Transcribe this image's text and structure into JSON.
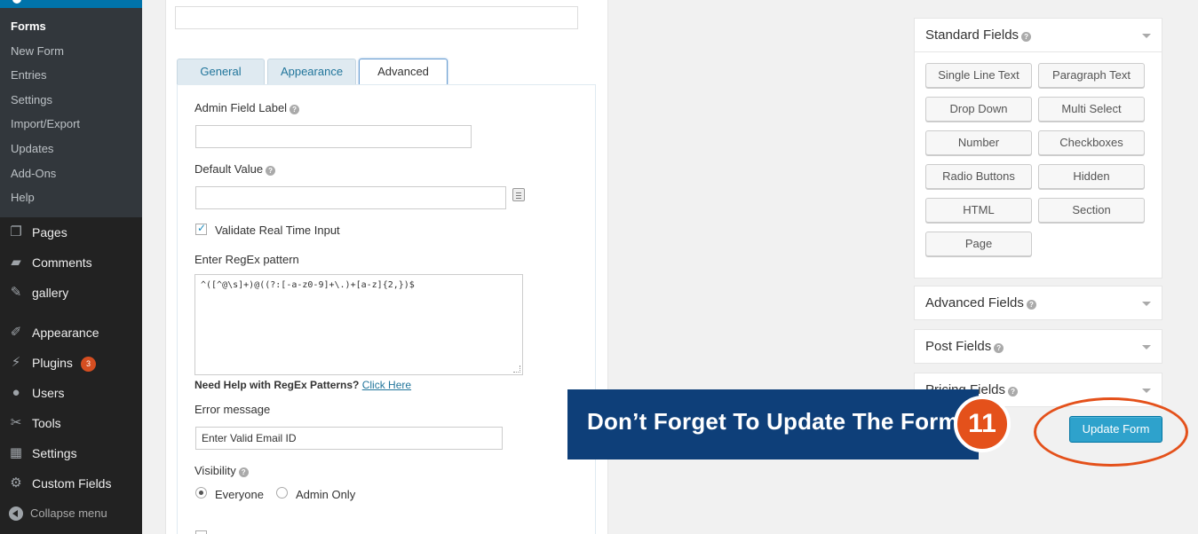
{
  "sidebar": {
    "submenu": [
      "Forms",
      "New Form",
      "Entries",
      "Settings",
      "Import/Export",
      "Updates",
      "Add-Ons",
      "Help"
    ],
    "menu": [
      {
        "label": "Pages",
        "icon": "pages-icon"
      },
      {
        "label": "Comments",
        "icon": "comments-icon"
      },
      {
        "label": "gallery",
        "icon": "pin-icon"
      },
      {
        "label": "Appearance",
        "icon": "paintbrush-icon"
      },
      {
        "label": "Plugins",
        "icon": "plugin-icon",
        "badge": "3"
      },
      {
        "label": "Users",
        "icon": "users-icon"
      },
      {
        "label": "Tools",
        "icon": "wrench-icon"
      },
      {
        "label": "Settings",
        "icon": "settings-icon"
      },
      {
        "label": "Custom Fields",
        "icon": "gear-icon"
      }
    ],
    "collapse_label": "Collapse menu"
  },
  "settings_panel": {
    "tabs": [
      "General",
      "Appearance",
      "Advanced"
    ],
    "active_tab": "Advanced",
    "admin_field_label": "Admin Field Label",
    "default_value_label": "Default Value",
    "validate_label": "Validate Real Time Input",
    "validate_checked": true,
    "regex_label": "Enter RegEx pattern",
    "regex_value": "^([^@\\s]+)@((?:[-a-z0-9]+\\.)+[a-z]{2,})$",
    "regex_help_text": "Need Help with RegEx Patterns?",
    "regex_help_link": "Click Here",
    "error_label": "Error message",
    "error_value": "Enter Valid Email ID",
    "visibility_label": "Visibility",
    "visibility_options": [
      "Everyone",
      "Admin Only"
    ],
    "visibility_selected": "Everyone"
  },
  "field_boxes": {
    "standard_title": "Standard Fields",
    "standard_buttons": [
      "Single Line Text",
      "Paragraph Text",
      "Drop Down",
      "Multi Select",
      "Number",
      "Checkboxes",
      "Radio Buttons",
      "Hidden",
      "HTML",
      "Section",
      "Page"
    ],
    "advanced_title": "Advanced Fields",
    "post_title": "Post Fields",
    "pricing_title": "Pricing Fields"
  },
  "annotation": {
    "banner_text": "Don’t Forget To Update The Form",
    "step_number": "11",
    "accent": "#e4511b",
    "banner_color": "#0e3f79"
  },
  "update_button": "Update Form"
}
